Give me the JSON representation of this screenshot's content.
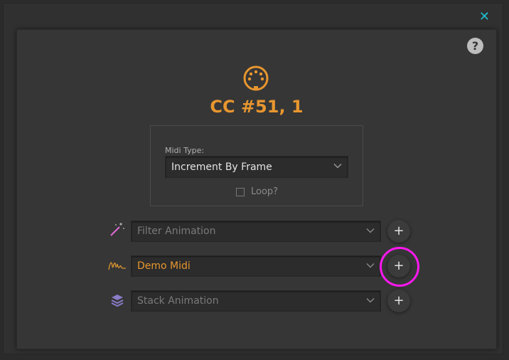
{
  "window": {
    "close_icon": "close-icon"
  },
  "dialog": {
    "help_label": "?",
    "title": "CC #51, 1",
    "icon": "midi-connector-icon",
    "accent_color": "#e8962f",
    "midi_type": {
      "label": "Midi Type:",
      "selected": "Increment By Frame"
    },
    "loop": {
      "label": "Loop?",
      "checked": false
    },
    "rows": [
      {
        "icon": "magic-wand-icon",
        "value": "",
        "placeholder": "Filter Animation",
        "add_label": "+"
      },
      {
        "icon": "signature-wave-icon",
        "value": "Demo Midi",
        "placeholder": "",
        "add_label": "+"
      },
      {
        "icon": "layers-stack-icon",
        "value": "",
        "placeholder": "Stack Animation",
        "add_label": "+"
      }
    ],
    "highlight_color": "#ff18f0"
  }
}
